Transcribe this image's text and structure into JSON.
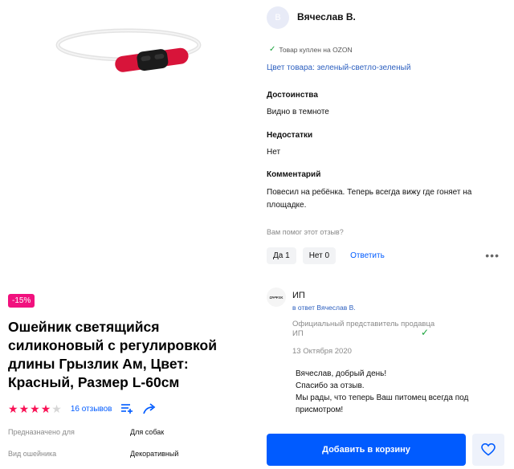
{
  "product": {
    "discount": "-15%",
    "title": "Ошейник светящийся силиконовый с регулировкой длины Грызлик Ам, Цвет: Красный, Размер L-60см",
    "rating": 4,
    "max_rating": 5,
    "reviews_count": "16 отзывов",
    "attributes": [
      {
        "key": "Предназначено для",
        "value": "Для собак"
      },
      {
        "key": "Вид ошейника",
        "value": "Декоративный"
      }
    ]
  },
  "review": {
    "avatar_letter": "В",
    "author": "Вячеслав В.",
    "bought_badge": "Товар куплен на OZON",
    "color_line": "Цвет товара: зеленый-светло-зеленый",
    "pros_heading": "Достоинства",
    "pros_text": "Видно в темноте",
    "cons_heading": "Недостатки",
    "cons_text": "Нет",
    "comment_heading": "Комментарий",
    "comment_text": "Повесил на ребёнка. Теперь всегда вижу где гоняет на площадке.",
    "helpful_question": "Вам помог этот отзыв?",
    "yes_label": "Да 1",
    "no_label": "Нет 0",
    "reply_label": "Ответить",
    "more_label": "•••"
  },
  "seller_reply": {
    "logo_text": "ΩΨΨΞΚ",
    "name": "ИП",
    "reply_to": "в ответ Вячеслав В.",
    "official": "Официальный представитель продавца",
    "official_ip": "ИП",
    "date": "13 Октября 2020",
    "lines": [
      "Вячеслав, добрый день!",
      "Спасибо за отзыв.",
      "Мы рады, что теперь Ваш питомец всегда под присмотром!"
    ]
  },
  "actions": {
    "add_to_cart": "Добавить в корзину"
  },
  "colors": {
    "accent": "#005bff",
    "discount": "#f1117e",
    "star": "#f91155",
    "check": "#19a33b"
  }
}
